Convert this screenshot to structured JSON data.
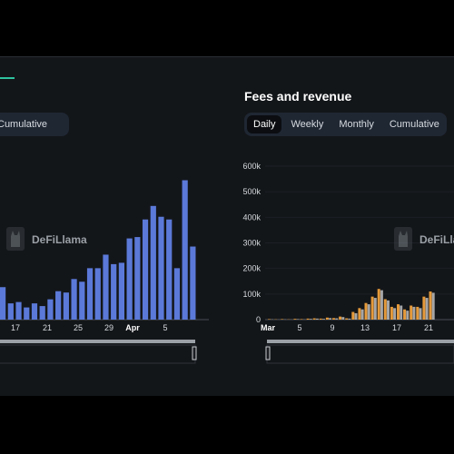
{
  "panels": {
    "left": {
      "tabs": [
        {
          "label": "Cumulative",
          "active": false
        }
      ],
      "watermark": "DeFiLlama"
    },
    "right": {
      "title": "Fees and revenue",
      "tabs": [
        {
          "label": "Daily",
          "active": true
        },
        {
          "label": "Weekly",
          "active": false
        },
        {
          "label": "Monthly",
          "active": false
        },
        {
          "label": "Cumulative",
          "active": false
        }
      ],
      "watermark": "DeFiLlama"
    }
  },
  "colors": {
    "background": "#131619",
    "accent": "#2ec29f",
    "bar_blue": "#5b79d8",
    "fees": "#e59a3a",
    "revenue": "#a6a6a6",
    "tab_bar": "#1f2733"
  },
  "chart_data": [
    {
      "type": "bar",
      "x_tick_labels": [
        "17",
        "21",
        "25",
        "29",
        "Apr",
        "5"
      ],
      "series": [
        {
          "values": [
            120,
            60,
            65,
            45,
            60,
            50,
            75,
            105,
            100,
            150,
            140,
            190,
            190,
            240,
            205,
            210,
            300,
            305,
            370,
            420,
            380,
            370,
            190,
            515,
            270
          ]
        }
      ],
      "watermark": "DeFiLlama"
    },
    {
      "type": "bar",
      "title": "Fees and revenue",
      "ylim": [
        0,
        600000
      ],
      "y_tick_labels": [
        "0",
        "100k",
        "200k",
        "300k",
        "400k",
        "500k",
        "600k"
      ],
      "x_tick_labels": [
        "Mar",
        "5",
        "9",
        "13",
        "17",
        "21"
      ],
      "series": [
        {
          "values": [
            2000,
            1000,
            2000,
            1000,
            3000,
            2000,
            4000,
            5000,
            4000,
            8000,
            6000,
            12000,
            5000,
            30000,
            45000,
            65000,
            90000,
            120000,
            80000,
            50000,
            60000,
            40000,
            55000,
            50000,
            90000,
            110000
          ]
        },
        {
          "values": [
            1000,
            500,
            1000,
            500,
            2000,
            1000,
            3000,
            4000,
            3000,
            6000,
            5000,
            10000,
            4000,
            25000,
            40000,
            60000,
            85000,
            115000,
            75000,
            45000,
            55000,
            35000,
            50000,
            45000,
            85000,
            105000
          ]
        }
      ],
      "watermark": "DeFiLlama"
    }
  ]
}
